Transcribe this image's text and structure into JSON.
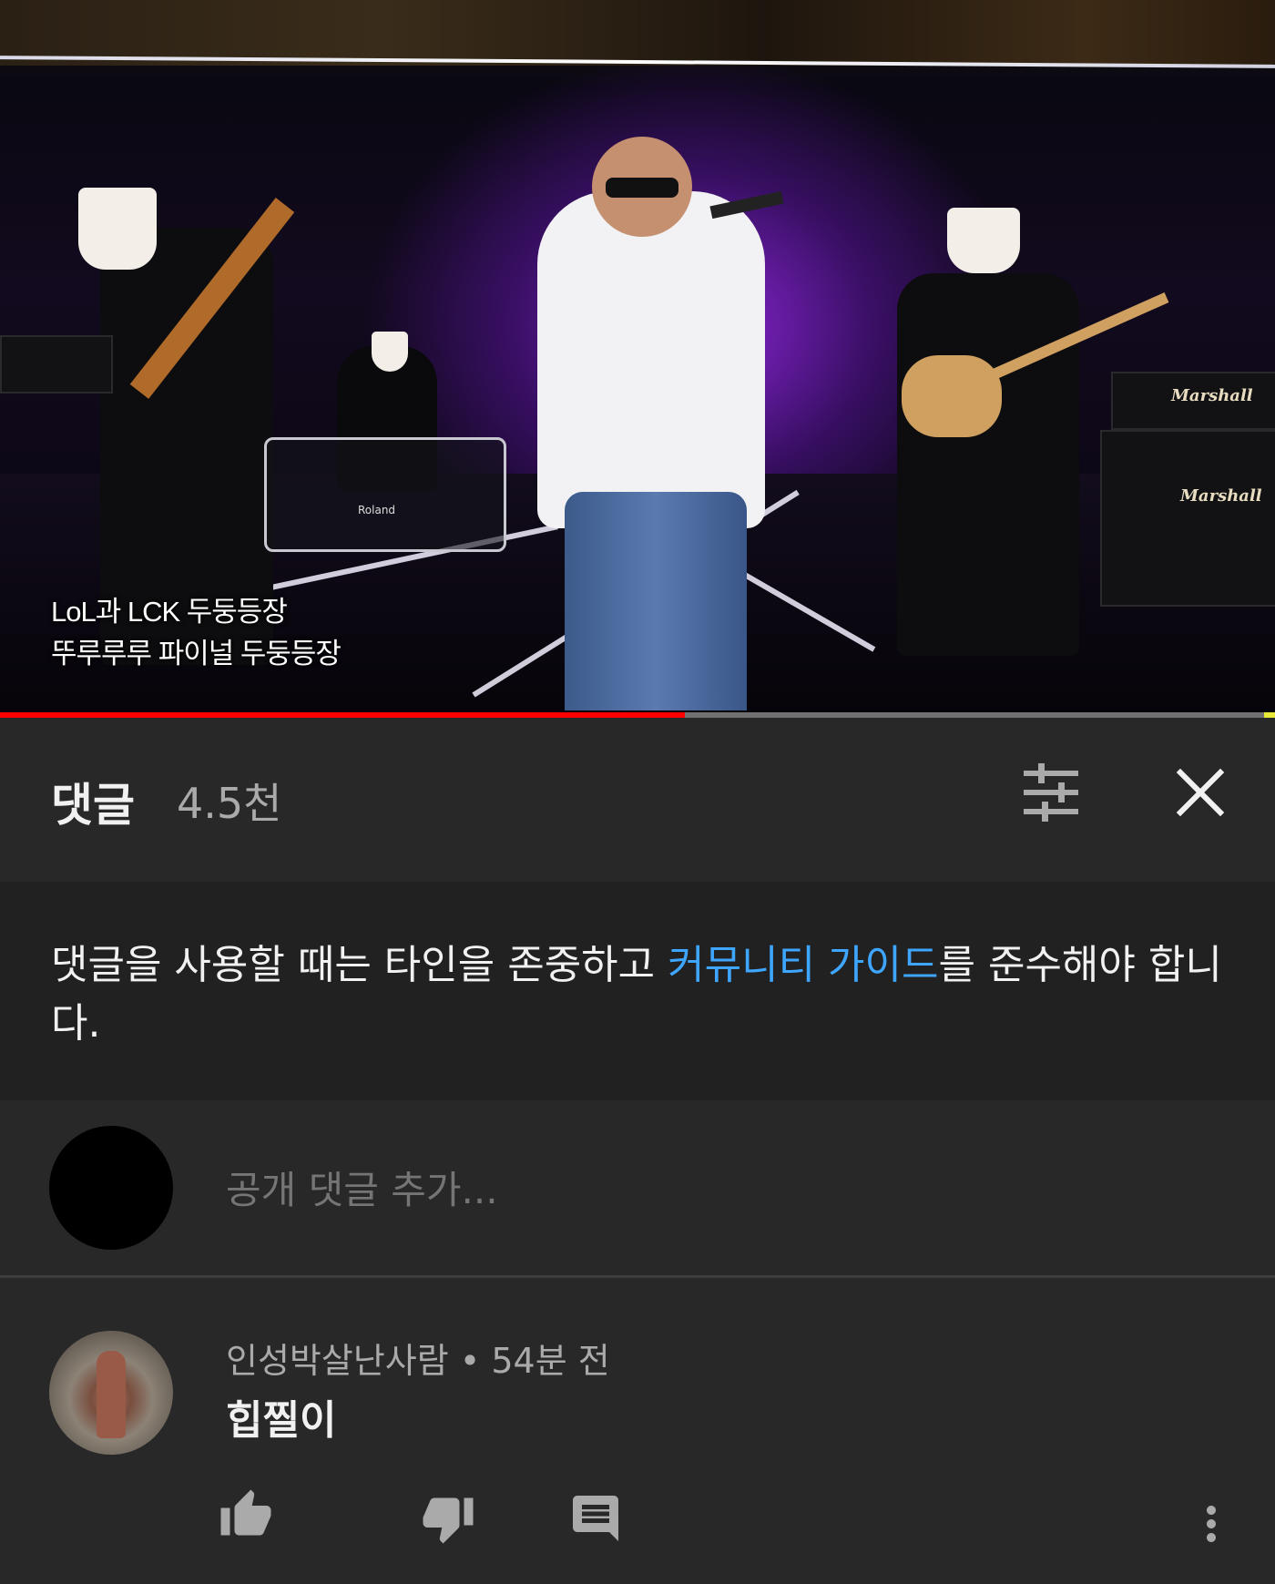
{
  "video": {
    "caption_line1": "LoL과 LCK 두둥등장",
    "caption_line2": "뚜루루루 파이널 두둥등장",
    "progress_fraction": 0.537,
    "amp_brand": "Marshall",
    "drum_brand": "Roland"
  },
  "comments_panel": {
    "title": "댓글",
    "count": "4.5천",
    "sort_icon": "sort-filter-icon",
    "close_icon": "close-icon",
    "guideline_before": "댓글을 사용할 때는 타인을 존중하고 ",
    "guideline_link": "커뮤니티 가이드",
    "guideline_after": "를 준수해야 합니다.",
    "add_comment_placeholder": "공개 댓글 추가..."
  },
  "comments": [
    {
      "author": "인성박살난사람",
      "separator": "•",
      "time": "54분 전",
      "text": "힙찔이",
      "actions": [
        "like-icon",
        "dislike-icon",
        "reply-icon",
        "more-vert-icon"
      ]
    }
  ],
  "colors": {
    "background": "#212121",
    "panel": "#282828",
    "link": "#3ea6ff",
    "progress": "#ff0000"
  }
}
